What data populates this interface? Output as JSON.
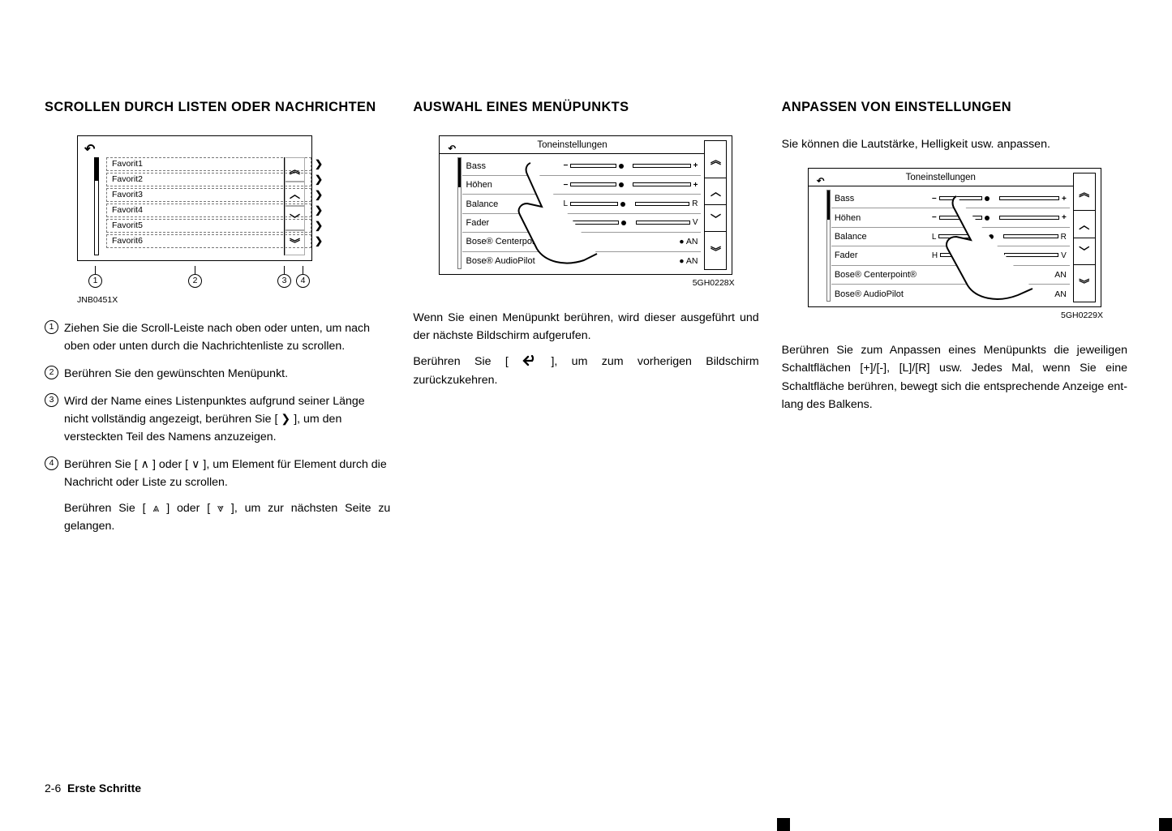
{
  "col1": {
    "heading": "SCROLLEN DURCH LISTEN ODER NACHRICHTEN",
    "fig": {
      "rows": [
        "Favorit1",
        "Favorit2",
        "Favorit3",
        "Favorit4",
        "Favorit5",
        "Favorit6"
      ],
      "caption": "JNB0451X"
    },
    "steps": [
      "Ziehen Sie die Scroll-Leiste nach oben oder unten, um nach oben oder unten durch die Nachrichtenliste zu scrollen.",
      "Berühren Sie den gewünschten Menü­punkt.",
      "Wird der Name eines Listenpunktes aufgrund seiner Länge nicht vollständig angezeigt, berühren Sie [ ❯ ], um den versteckten Teil des Namens anzuzeigen.",
      "Berühren Sie [  ∧  ] oder [  ∨  ], um Element für Element durch die Nachricht oder Liste zu scrollen."
    ],
    "subnote": "Berühren Sie [ ⩓ ] oder [ ⩔ ], um zur nächsten Seite zu gelangen."
  },
  "col2": {
    "heading": "AUSWAHL EINES MENÜPUNKTS",
    "fig": {
      "title": "Toneinstellungen",
      "caption": "5GH0228X",
      "rows": [
        {
          "label": "Bass",
          "type": "slider",
          "minus": "−",
          "plus": "+"
        },
        {
          "label": "Höhen",
          "type": "slider",
          "minus": "−",
          "plus": "+"
        },
        {
          "label": "Balance",
          "type": "slider",
          "left": "L",
          "right": "R"
        },
        {
          "label": "Fader",
          "type": "slider",
          "left": "H",
          "right": "V"
        },
        {
          "label": "Bose® Centerpoint®",
          "type": "on",
          "val": "● AN"
        },
        {
          "label": "Bose® AudioPilot",
          "type": "on",
          "val": "● AN"
        }
      ]
    },
    "para1": "Wenn Sie einen Menüpunkt berühren, wird die­ser ausgeführt und der nächste Bildschirm auf­gerufen.",
    "para2a": "Berühren Sie [ ",
    "para2b": " ], um zum vorherigen Bild­schirm zurückzukehren."
  },
  "col3": {
    "heading": "ANPASSEN VON EINSTELLUNGEN",
    "intro": "Sie können die Lautstärke, Helligkeit usw. an­passen.",
    "fig": {
      "title": "Toneinstellungen",
      "caption": "5GH0229X",
      "rows": [
        {
          "label": "Bass",
          "type": "slider",
          "minus": "−",
          "plus": "+"
        },
        {
          "label": "Höhen",
          "type": "slider",
          "minus": "−",
          "plus": "+"
        },
        {
          "label": "Balance",
          "type": "slider",
          "left": "L",
          "right": "R"
        },
        {
          "label": "Fader",
          "type": "slider",
          "left": "H",
          "right": "V"
        },
        {
          "label": "Bose® Centerpoint®",
          "type": "on",
          "val": "AN"
        },
        {
          "label": "Bose® AudioPilot",
          "type": "on",
          "val": "AN"
        }
      ]
    },
    "para": "Berühren Sie zum Anpassen eines Menüpunkts die jeweiligen Schaltflächen [+]/[-], [L]/[R] usw. Jedes Mal, wenn Sie eine Schaltfläche berüh­ren, bewegt sich die entsprechende Anzeige ent­lang des Balkens."
  },
  "footer": {
    "page": "2-6",
    "section": "Erste Schritte"
  },
  "icons": {
    "back": "↶",
    "dblup": "︽",
    "up": "︿",
    "down": "﹀",
    "dbldown": "︾",
    "chev": "❯"
  }
}
